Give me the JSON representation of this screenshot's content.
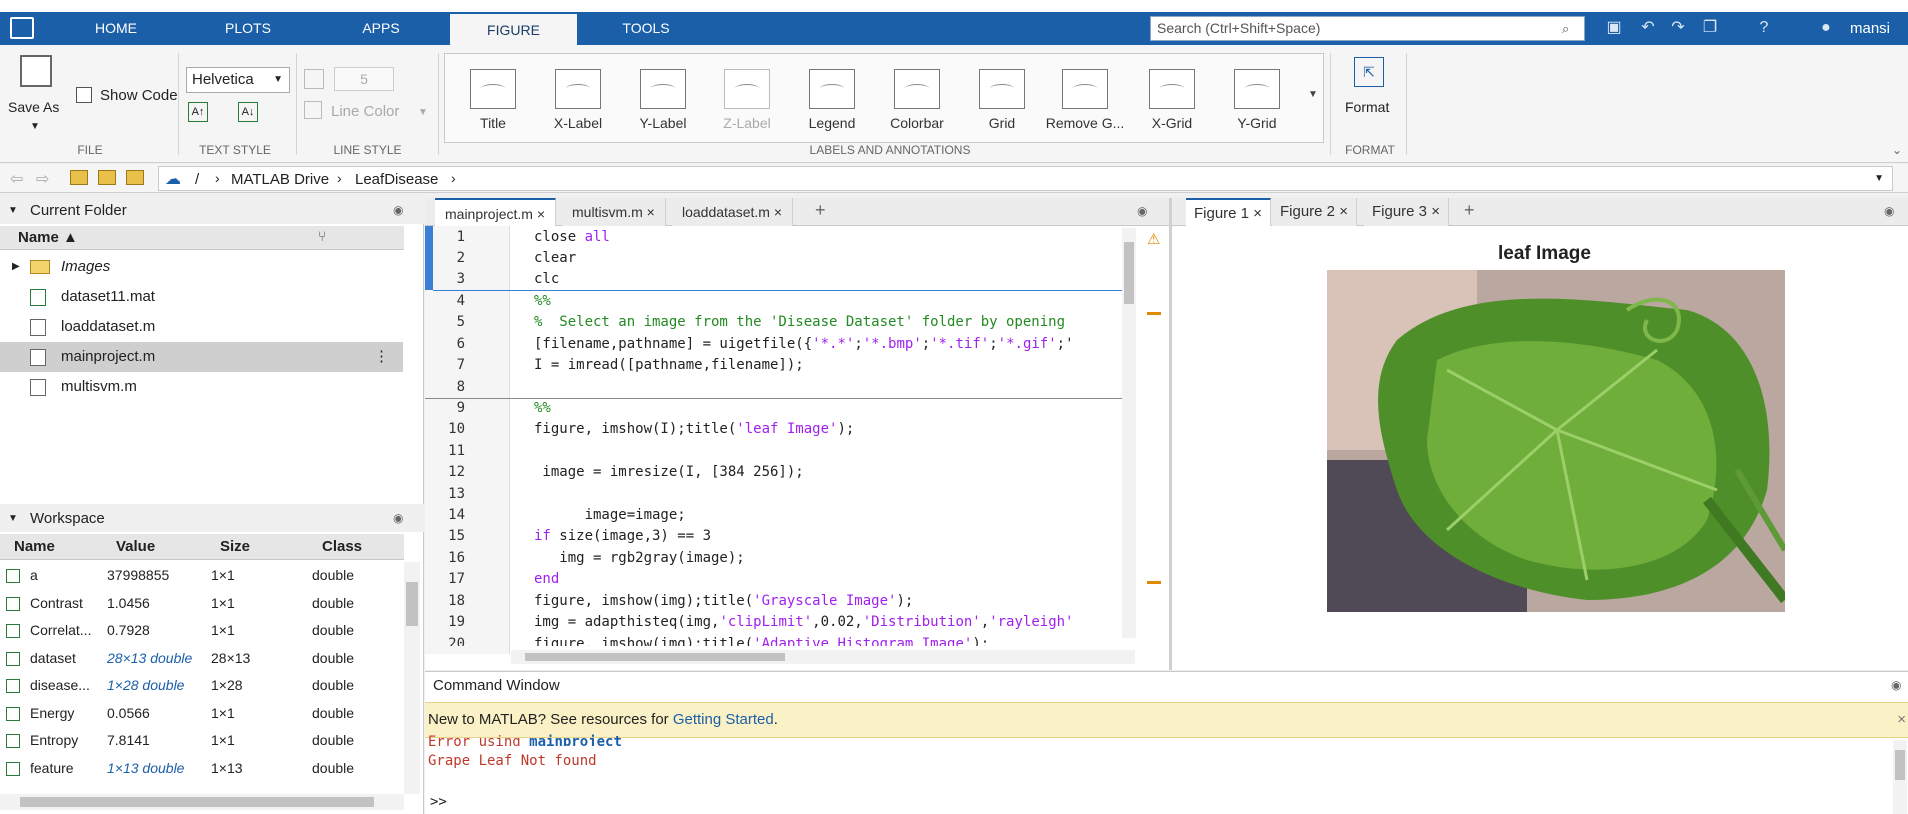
{
  "toolbar": {
    "tabs": [
      "HOME",
      "PLOTS",
      "APPS",
      "FIGURE",
      "TOOLS"
    ],
    "search_placeholder": "Search (Ctrl+Shift+Space)",
    "user": "mansi"
  },
  "ribbon": {
    "file": {
      "save_as": "Save As",
      "show_code": "Show Code",
      "label": "FILE"
    },
    "text_style": {
      "font": "Helvetica",
      "label": "TEXT STYLE"
    },
    "line_style": {
      "width": "5",
      "line_color": "Line Color",
      "label": "LINE STYLE"
    },
    "labels": {
      "buttons": [
        "Title",
        "X-Label",
        "Y-Label",
        "Z-Label",
        "Legend",
        "Colorbar",
        "Grid",
        "Remove G...",
        "X-Grid",
        "Y-Grid"
      ],
      "label": "LABELS AND ANNOTATIONS"
    },
    "format": {
      "button": "Format",
      "label": "FORMAT"
    }
  },
  "address": {
    "root": "/",
    "parts": [
      "MATLAB Drive",
      "LeafDisease"
    ]
  },
  "current_folder": {
    "title": "Current Folder",
    "header": "Name ▲",
    "items": [
      {
        "name": "Images",
        "type": "folder"
      },
      {
        "name": "dataset11.mat",
        "type": "mat"
      },
      {
        "name": "loaddataset.m",
        "type": "script"
      },
      {
        "name": "mainproject.m",
        "type": "script"
      },
      {
        "name": "multisvm.m",
        "type": "function"
      }
    ]
  },
  "workspace": {
    "title": "Workspace",
    "headers": [
      "Name",
      "Value",
      "Size",
      "Class"
    ],
    "rows": [
      {
        "name": "a",
        "value": "37998855",
        "size": "1×1",
        "class": "double"
      },
      {
        "name": "Contrast",
        "value": "1.0456",
        "size": "1×1",
        "class": "double"
      },
      {
        "name": "Correlat...",
        "value": "0.7928",
        "size": "1×1",
        "class": "double"
      },
      {
        "name": "dataset",
        "value": "28×13 double",
        "size": "28×13",
        "class": "double"
      },
      {
        "name": "disease...",
        "value": "1×28 double",
        "size": "1×28",
        "class": "double"
      },
      {
        "name": "Energy",
        "value": "0.0566",
        "size": "1×1",
        "class": "double"
      },
      {
        "name": "Entropy",
        "value": "7.8141",
        "size": "1×1",
        "class": "double"
      },
      {
        "name": "feature",
        "value": "1×13 double",
        "size": "1×13",
        "class": "double"
      }
    ]
  },
  "editor": {
    "tabs": [
      "mainproject.m",
      "multisvm.m",
      "loaddataset.m"
    ],
    "line_numbers": [
      "1",
      "2",
      "3",
      "4",
      "5",
      "6",
      "7",
      "8",
      "9",
      "10",
      "11",
      "12",
      "13",
      "14",
      "15",
      "16",
      "17",
      "18",
      "19",
      "20"
    ]
  },
  "figure": {
    "tabs": [
      "Figure 1",
      "Figure 2",
      "Figure 3"
    ],
    "title": "leaf Image"
  },
  "command_window": {
    "title": "Command Window",
    "banner_prefix": "New to MATLAB? See resources for ",
    "banner_link": "Getting Started",
    "banner_suffix": ".",
    "error_prefix": "Error using ",
    "error_link": "mainproject",
    "error_message": "Grape Leaf Not found",
    "prompt": ">>"
  }
}
